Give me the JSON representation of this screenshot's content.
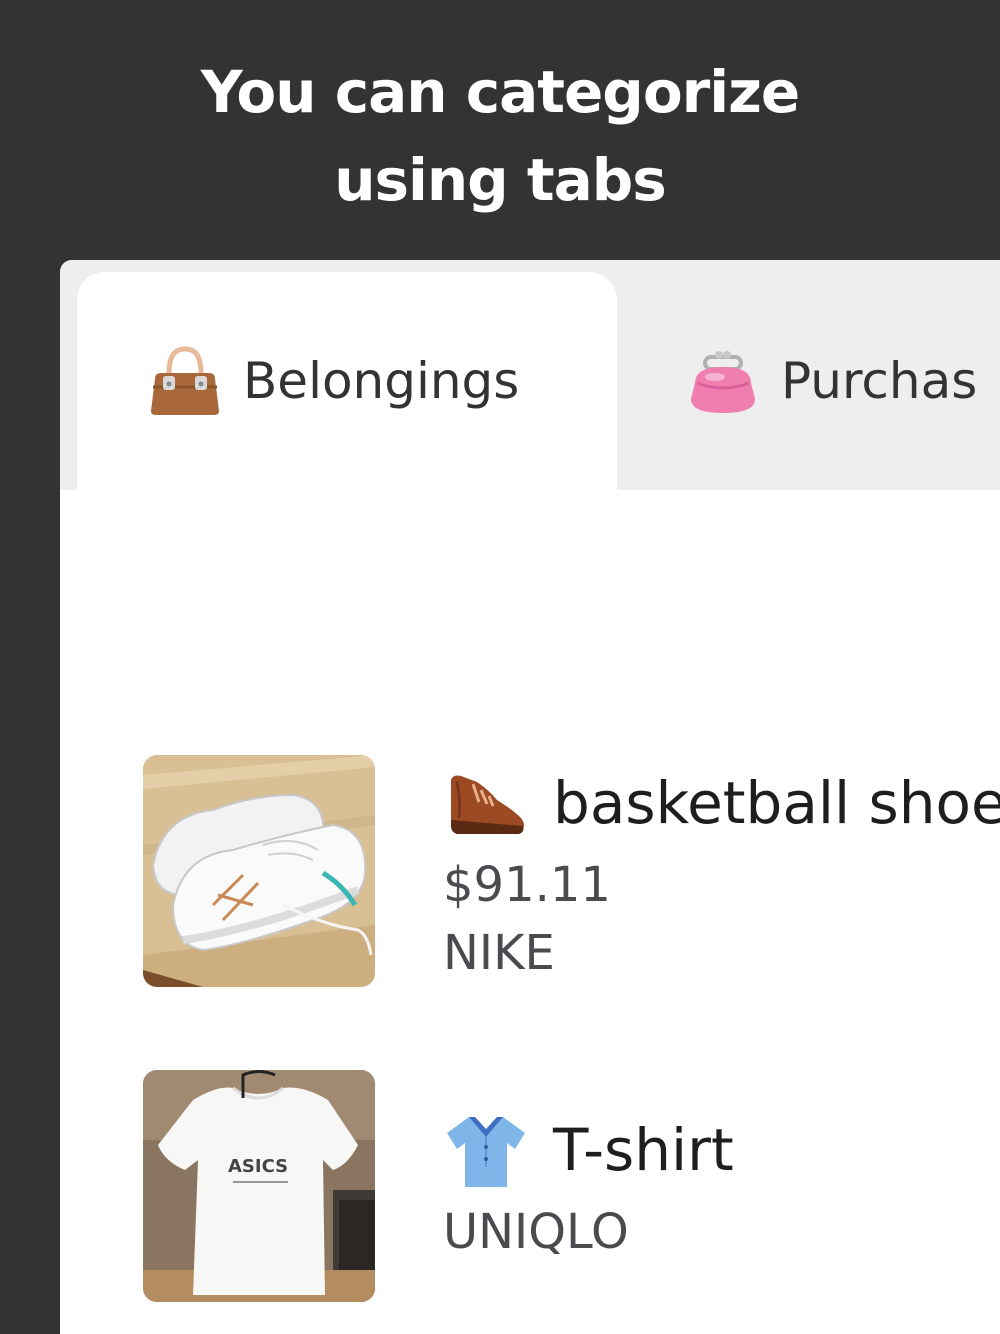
{
  "headline": {
    "line1": "You can categorize",
    "line2": "using tabs"
  },
  "tabs": [
    {
      "label": "Belongings",
      "icon": "handbag-icon",
      "active": true
    },
    {
      "label": "Purchas",
      "icon": "purse-icon",
      "active": false
    }
  ],
  "items": [
    {
      "name": "basketball shoe",
      "icon": "shoe-icon",
      "price": "$91.11",
      "brand": "NIKE",
      "photo": "sneakers-photo"
    },
    {
      "name": "T-shirt",
      "icon": "shirt-icon",
      "brand": "UNIQLO",
      "photo": "tshirt-photo"
    }
  ],
  "colors": {
    "background": "#333333",
    "panel": "#ffffff",
    "tab_strip": "#eeeeee",
    "text_primary": "#1e1e1e",
    "text_secondary": "#4a4a4f"
  }
}
